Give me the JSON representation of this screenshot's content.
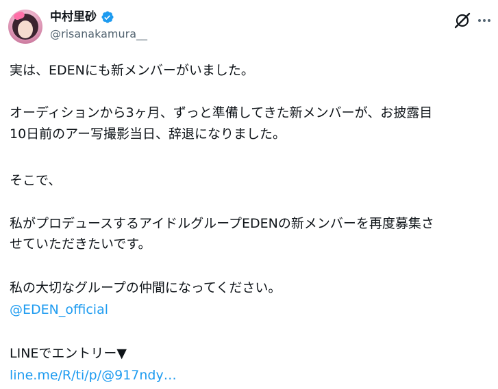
{
  "author": {
    "display_name": "中村里砂",
    "handle": "@risanakamura__",
    "verified_color": "#1d9bf0"
  },
  "icons": {
    "verified": "verified-badge-icon",
    "grok": "grok-icon",
    "more": "more-dots-icon"
  },
  "post": {
    "line1": "実は、EDENにも新メンバーがいました。",
    "line2": "オーディションから3ヶ月、ずっと準備してきた新メンバーが、お披露目",
    "line3": "10日前のアー写撮影当日、辞退になりました。",
    "line4": "そこで、",
    "line5": "私がプロデュースするアイドルグループEDENの新メンバーを再度募集さ",
    "line6": "せていただきたいです。",
    "line7": "私の大切なグループの仲間になってください。",
    "mention": "@EDEN_official",
    "line8": "LINEでエントリー▼",
    "url": "line.me/R/ti/p/@917ndy…"
  },
  "colors": {
    "text": "#0f1419",
    "secondary": "#536471",
    "link": "#1d9bf0"
  }
}
